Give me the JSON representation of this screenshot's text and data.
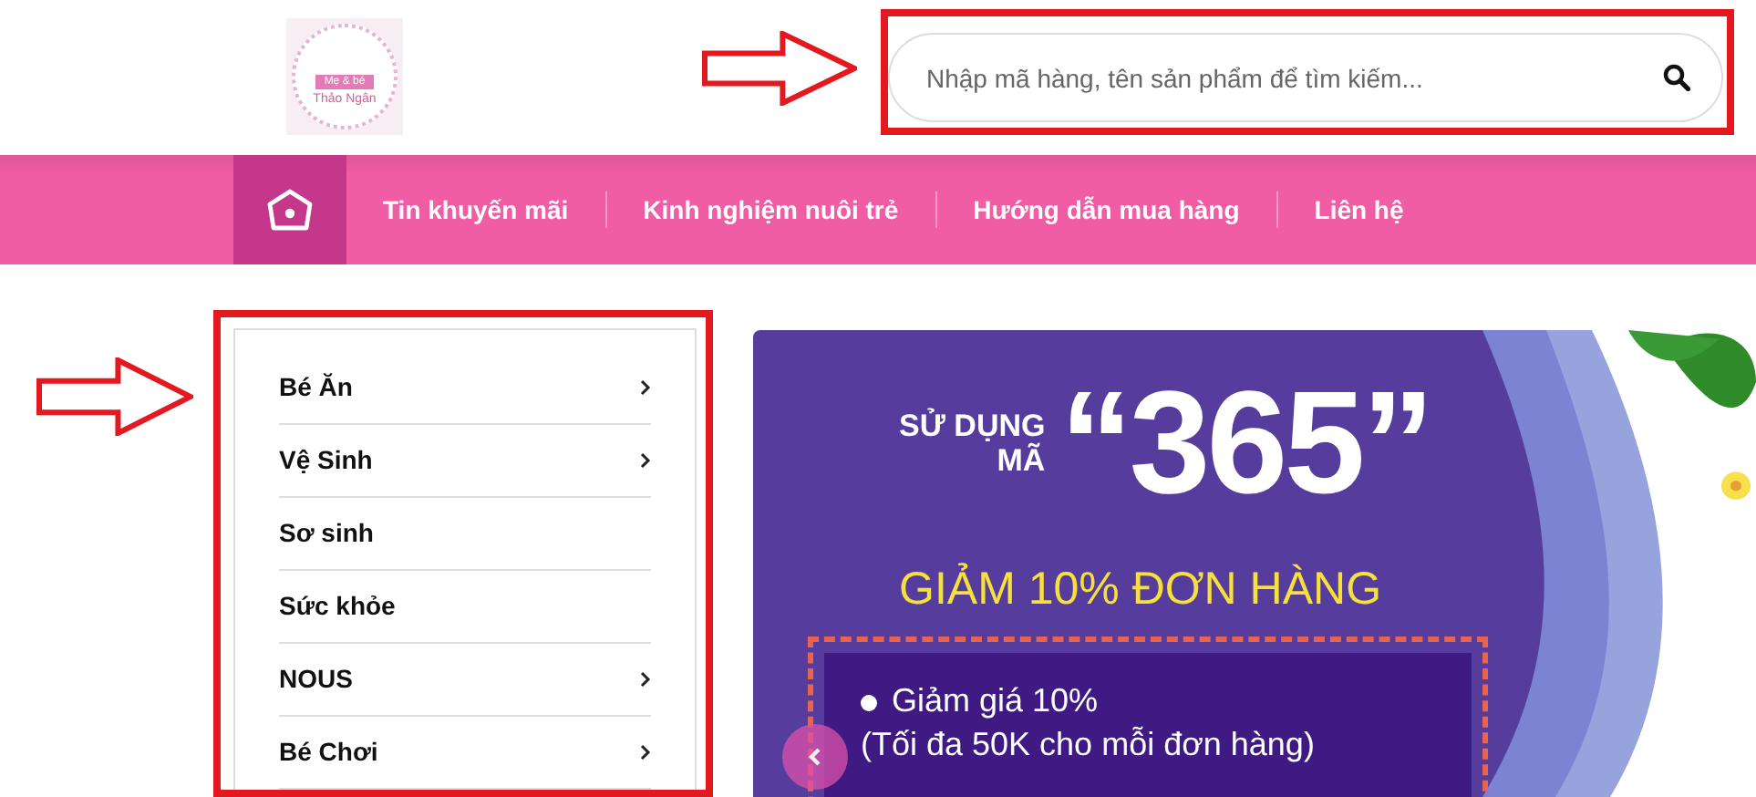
{
  "logo": {
    "line_1": "Mẹ & bé",
    "line_2": "Thảo Ngân"
  },
  "search": {
    "placeholder": "Nhập mã hàng, tên sản phẩm để tìm kiếm..."
  },
  "nav": {
    "items": [
      {
        "label": "Tin khuyến mãi"
      },
      {
        "label": "Kinh nghiệm nuôi trẻ"
      },
      {
        "label": "Hướng dẫn mua hàng"
      },
      {
        "label": "Liên hệ"
      }
    ]
  },
  "sidebar": {
    "items": [
      {
        "label": "Bé Ăn",
        "has_submenu": true
      },
      {
        "label": "Vệ Sinh",
        "has_submenu": true
      },
      {
        "label": "Sơ sinh",
        "has_submenu": false
      },
      {
        "label": "Sức khỏe",
        "has_submenu": false
      },
      {
        "label": "NOUS",
        "has_submenu": true
      },
      {
        "label": "Bé Chơi",
        "has_submenu": true
      }
    ]
  },
  "banner": {
    "use_code_line_1": "SỬ DỤNG",
    "use_code_line_2": "MÃ",
    "code": "“365”",
    "headline": "GIẢM 10% ĐƠN HÀNG",
    "bullet_line_1": "Giảm giá 10%",
    "bullet_line_2": "(Tối đa 50K cho mỗi đơn hàng)"
  }
}
